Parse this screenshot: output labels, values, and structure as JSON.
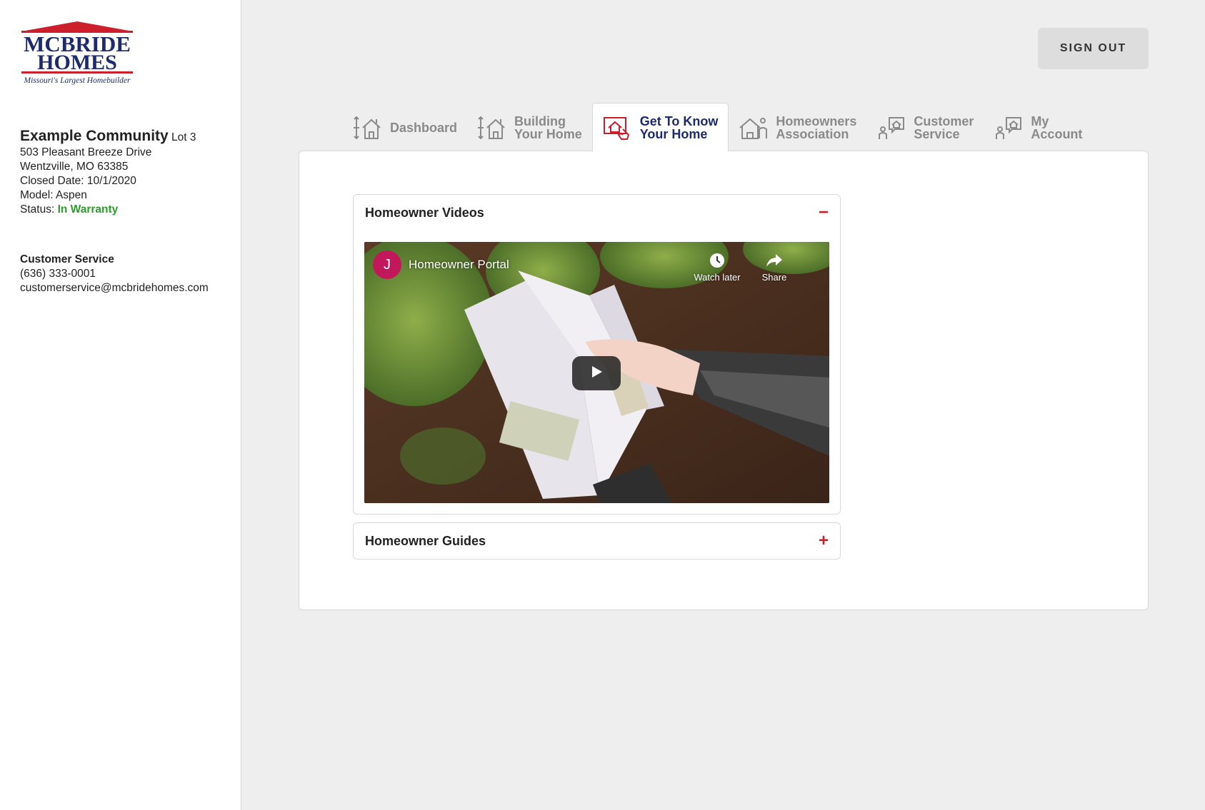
{
  "brand": {
    "logo_line1": "MCBRIDE",
    "logo_line2": "HOMES",
    "tagline": "Missouri's Largest Homebuilder",
    "navy": "#1d2a6e",
    "red": "#cc1f2d"
  },
  "property": {
    "community": "Example Community",
    "lot": "Lot 3",
    "address1": "503 Pleasant Breeze Drive",
    "address2": "Wentzville, MO 63385",
    "closed_date": "Closed Date: 10/1/2020",
    "model": "Model: Aspen",
    "status_label": "Status:",
    "status_value": "In Warranty",
    "status_color": "#2a9d2a"
  },
  "customer_service": {
    "title": "Customer Service",
    "phone": "(636) 333-0001",
    "email": "customerservice@mcbridehomes.com"
  },
  "header": {
    "sign_out": "SIGN OUT"
  },
  "tabs": [
    {
      "line1": "Dashboard",
      "line2": "",
      "icon": "house-arrows-icon",
      "active": false
    },
    {
      "line1": "Building",
      "line2": "Your Home",
      "icon": "house-arrows-icon",
      "active": false
    },
    {
      "line1": "Get To Know",
      "line2": "Your Home",
      "icon": "house-hand-icon",
      "active": true
    },
    {
      "line1": "Homeowners",
      "line2": "Association",
      "icon": "house-people-icon",
      "active": false
    },
    {
      "line1": "Customer",
      "line2": "Service",
      "icon": "people-chat-icon",
      "active": false
    },
    {
      "line1": "My",
      "line2": "Account",
      "icon": "people-chat-icon",
      "active": false
    }
  ],
  "sections": {
    "videos": {
      "title": "Homeowner Videos",
      "toggle": "−",
      "expanded": true,
      "video": {
        "channel_initial": "J",
        "title": "Homeowner Portal",
        "watch_later": "Watch later",
        "share": "Share"
      }
    },
    "guides": {
      "title": "Homeowner Guides",
      "toggle": "+",
      "expanded": false
    }
  }
}
